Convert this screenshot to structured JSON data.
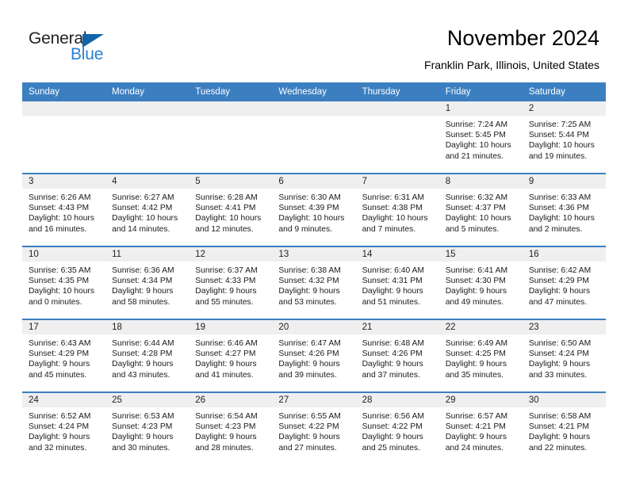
{
  "brand": {
    "name_part1": "General",
    "name_part2": "Blue",
    "triangle_color": "#1264a9",
    "blue_color": "#2a7fd4"
  },
  "header": {
    "title": "November 2024",
    "location": "Franklin Park, Illinois, United States"
  },
  "theme": {
    "header_background": "#3c7fc1",
    "header_text": "#ffffff",
    "daynum_band": "#efeff0",
    "cell_background": "#ffffff",
    "row_divider": "#3c7fc1"
  },
  "calendar": {
    "weekday_headers": [
      "Sunday",
      "Monday",
      "Tuesday",
      "Wednesday",
      "Thursday",
      "Friday",
      "Saturday"
    ],
    "weeks": [
      [
        {
          "day": "",
          "sunrise": "",
          "sunset": "",
          "daylight": ""
        },
        {
          "day": "",
          "sunrise": "",
          "sunset": "",
          "daylight": ""
        },
        {
          "day": "",
          "sunrise": "",
          "sunset": "",
          "daylight": ""
        },
        {
          "day": "",
          "sunrise": "",
          "sunset": "",
          "daylight": ""
        },
        {
          "day": "",
          "sunrise": "",
          "sunset": "",
          "daylight": ""
        },
        {
          "day": "1",
          "sunrise": "Sunrise: 7:24 AM",
          "sunset": "Sunset: 5:45 PM",
          "daylight": "Daylight: 10 hours and 21 minutes."
        },
        {
          "day": "2",
          "sunrise": "Sunrise: 7:25 AM",
          "sunset": "Sunset: 5:44 PM",
          "daylight": "Daylight: 10 hours and 19 minutes."
        }
      ],
      [
        {
          "day": "3",
          "sunrise": "Sunrise: 6:26 AM",
          "sunset": "Sunset: 4:43 PM",
          "daylight": "Daylight: 10 hours and 16 minutes."
        },
        {
          "day": "4",
          "sunrise": "Sunrise: 6:27 AM",
          "sunset": "Sunset: 4:42 PM",
          "daylight": "Daylight: 10 hours and 14 minutes."
        },
        {
          "day": "5",
          "sunrise": "Sunrise: 6:28 AM",
          "sunset": "Sunset: 4:41 PM",
          "daylight": "Daylight: 10 hours and 12 minutes."
        },
        {
          "day": "6",
          "sunrise": "Sunrise: 6:30 AM",
          "sunset": "Sunset: 4:39 PM",
          "daylight": "Daylight: 10 hours and 9 minutes."
        },
        {
          "day": "7",
          "sunrise": "Sunrise: 6:31 AM",
          "sunset": "Sunset: 4:38 PM",
          "daylight": "Daylight: 10 hours and 7 minutes."
        },
        {
          "day": "8",
          "sunrise": "Sunrise: 6:32 AM",
          "sunset": "Sunset: 4:37 PM",
          "daylight": "Daylight: 10 hours and 5 minutes."
        },
        {
          "day": "9",
          "sunrise": "Sunrise: 6:33 AM",
          "sunset": "Sunset: 4:36 PM",
          "daylight": "Daylight: 10 hours and 2 minutes."
        }
      ],
      [
        {
          "day": "10",
          "sunrise": "Sunrise: 6:35 AM",
          "sunset": "Sunset: 4:35 PM",
          "daylight": "Daylight: 10 hours and 0 minutes."
        },
        {
          "day": "11",
          "sunrise": "Sunrise: 6:36 AM",
          "sunset": "Sunset: 4:34 PM",
          "daylight": "Daylight: 9 hours and 58 minutes."
        },
        {
          "day": "12",
          "sunrise": "Sunrise: 6:37 AM",
          "sunset": "Sunset: 4:33 PM",
          "daylight": "Daylight: 9 hours and 55 minutes."
        },
        {
          "day": "13",
          "sunrise": "Sunrise: 6:38 AM",
          "sunset": "Sunset: 4:32 PM",
          "daylight": "Daylight: 9 hours and 53 minutes."
        },
        {
          "day": "14",
          "sunrise": "Sunrise: 6:40 AM",
          "sunset": "Sunset: 4:31 PM",
          "daylight": "Daylight: 9 hours and 51 minutes."
        },
        {
          "day": "15",
          "sunrise": "Sunrise: 6:41 AM",
          "sunset": "Sunset: 4:30 PM",
          "daylight": "Daylight: 9 hours and 49 minutes."
        },
        {
          "day": "16",
          "sunrise": "Sunrise: 6:42 AM",
          "sunset": "Sunset: 4:29 PM",
          "daylight": "Daylight: 9 hours and 47 minutes."
        }
      ],
      [
        {
          "day": "17",
          "sunrise": "Sunrise: 6:43 AM",
          "sunset": "Sunset: 4:29 PM",
          "daylight": "Daylight: 9 hours and 45 minutes."
        },
        {
          "day": "18",
          "sunrise": "Sunrise: 6:44 AM",
          "sunset": "Sunset: 4:28 PM",
          "daylight": "Daylight: 9 hours and 43 minutes."
        },
        {
          "day": "19",
          "sunrise": "Sunrise: 6:46 AM",
          "sunset": "Sunset: 4:27 PM",
          "daylight": "Daylight: 9 hours and 41 minutes."
        },
        {
          "day": "20",
          "sunrise": "Sunrise: 6:47 AM",
          "sunset": "Sunset: 4:26 PM",
          "daylight": "Daylight: 9 hours and 39 minutes."
        },
        {
          "day": "21",
          "sunrise": "Sunrise: 6:48 AM",
          "sunset": "Sunset: 4:26 PM",
          "daylight": "Daylight: 9 hours and 37 minutes."
        },
        {
          "day": "22",
          "sunrise": "Sunrise: 6:49 AM",
          "sunset": "Sunset: 4:25 PM",
          "daylight": "Daylight: 9 hours and 35 minutes."
        },
        {
          "day": "23",
          "sunrise": "Sunrise: 6:50 AM",
          "sunset": "Sunset: 4:24 PM",
          "daylight": "Daylight: 9 hours and 33 minutes."
        }
      ],
      [
        {
          "day": "24",
          "sunrise": "Sunrise: 6:52 AM",
          "sunset": "Sunset: 4:24 PM",
          "daylight": "Daylight: 9 hours and 32 minutes."
        },
        {
          "day": "25",
          "sunrise": "Sunrise: 6:53 AM",
          "sunset": "Sunset: 4:23 PM",
          "daylight": "Daylight: 9 hours and 30 minutes."
        },
        {
          "day": "26",
          "sunrise": "Sunrise: 6:54 AM",
          "sunset": "Sunset: 4:23 PM",
          "daylight": "Daylight: 9 hours and 28 minutes."
        },
        {
          "day": "27",
          "sunrise": "Sunrise: 6:55 AM",
          "sunset": "Sunset: 4:22 PM",
          "daylight": "Daylight: 9 hours and 27 minutes."
        },
        {
          "day": "28",
          "sunrise": "Sunrise: 6:56 AM",
          "sunset": "Sunset: 4:22 PM",
          "daylight": "Daylight: 9 hours and 25 minutes."
        },
        {
          "day": "29",
          "sunrise": "Sunrise: 6:57 AM",
          "sunset": "Sunset: 4:21 PM",
          "daylight": "Daylight: 9 hours and 24 minutes."
        },
        {
          "day": "30",
          "sunrise": "Sunrise: 6:58 AM",
          "sunset": "Sunset: 4:21 PM",
          "daylight": "Daylight: 9 hours and 22 minutes."
        }
      ]
    ]
  }
}
